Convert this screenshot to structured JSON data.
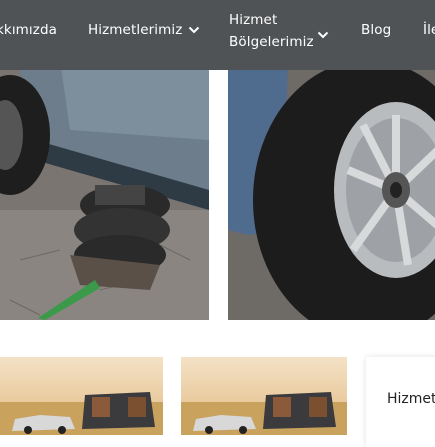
{
  "nav": {
    "items": [
      {
        "label": "kkımızda"
      },
      {
        "label": "Hizmetlerimiz"
      },
      {
        "label_line1": "Hizmet",
        "label_line2": "Bölgelerimiz"
      },
      {
        "label": "Blog"
      },
      {
        "label": "İle"
      }
    ]
  },
  "sidebar": {
    "title": "Hizmet"
  },
  "colors": {
    "navbar_bg": "#505356",
    "nav_text": "#ffffff"
  },
  "icons": [
    "chevron-down-icon",
    "chevron-down-icon"
  ]
}
